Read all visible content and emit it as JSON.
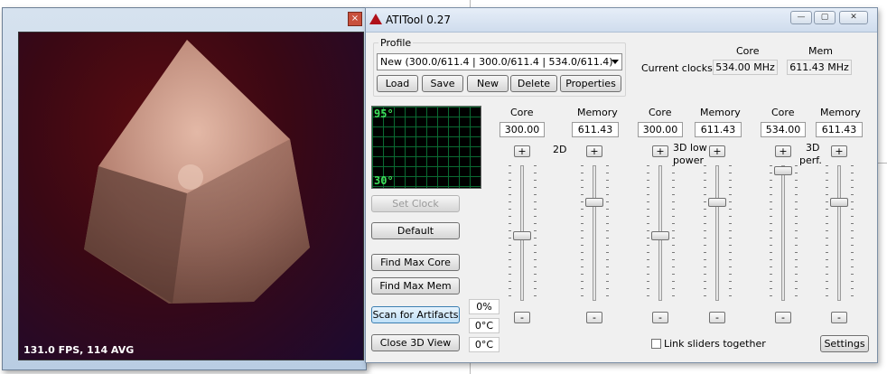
{
  "view3d": {
    "fps_text": "131.0 FPS, 114 AVG",
    "close_glyph": "×"
  },
  "window": {
    "title": "ATITool 0.27",
    "min_glyph": "—",
    "max_glyph": "▢",
    "close_glyph": "✕"
  },
  "profile": {
    "group_label": "Profile",
    "selected": "New (300.0/611.4 | 300.0/611.4 | 534.0/611.4)",
    "buttons": {
      "load": "Load",
      "save": "Save",
      "new": "New",
      "delete": "Delete",
      "properties": "Properties"
    }
  },
  "current_clocks": {
    "label": "Current clocks:",
    "core_header": "Core",
    "mem_header": "Mem",
    "core_value": "534.00 MHz",
    "mem_value": "611.43 MHz"
  },
  "temperature": {
    "top": "95°",
    "bottom": "30°"
  },
  "actions": {
    "set_clock": "Set Clock",
    "default": "Default",
    "find_max_core": "Find Max Core",
    "find_max_mem": "Find Max Mem",
    "scan_artifacts": "Scan for Artifacts",
    "close_3d": "Close 3D View"
  },
  "readouts": {
    "percent": "0%",
    "temp1": "0°C",
    "temp2": "0°C"
  },
  "modes": [
    {
      "name": "2D",
      "core_label": "Core",
      "mem_label": "Memory",
      "core_value": "300.00",
      "mem_value": "611.43",
      "core_slider_level": 0.48,
      "mem_slider_level": 0.73
    },
    {
      "name": "3D low power",
      "name_line1": "3D low",
      "name_line2": "power",
      "core_label": "Core",
      "mem_label": "Memory",
      "core_value": "300.00",
      "mem_value": "611.43",
      "core_slider_level": 0.48,
      "mem_slider_level": 0.73
    },
    {
      "name": "3D perf.",
      "name_line1": "3D",
      "name_line2": "perf.",
      "core_label": "Core",
      "mem_label": "Memory",
      "core_value": "534.00",
      "mem_value": "611.43",
      "core_slider_level": 0.96,
      "mem_slider_level": 0.73
    }
  ],
  "plus_glyph": "+",
  "minus_glyph": "-",
  "link_sliders": {
    "label": "Link sliders together",
    "checked": false
  },
  "settings_label": "Settings"
}
